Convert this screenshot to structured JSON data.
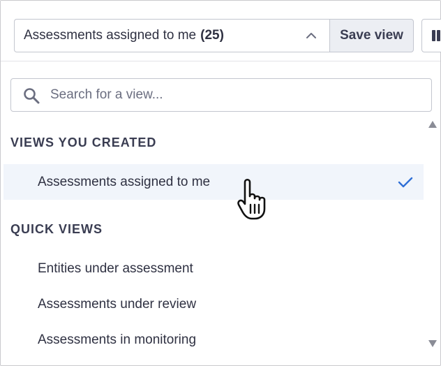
{
  "view_select": {
    "label": "Assessments assigned to me",
    "count": "(25)",
    "chevron_icon": "chevron-up-icon"
  },
  "toolbar": {
    "save_label": "Save view",
    "extra_icon": "columns-icon"
  },
  "search": {
    "placeholder": "Search for a view...",
    "value": "",
    "icon": "search-icon"
  },
  "sections": {
    "created": {
      "header": "VIEWS YOU CREATED",
      "items": [
        {
          "label": "Assessments assigned to me",
          "selected": true
        }
      ]
    },
    "quick": {
      "header": "QUICK VIEWS",
      "items": [
        {
          "label": "Entities under assessment"
        },
        {
          "label": "Assessments under review"
        },
        {
          "label": "Assessments in monitoring"
        }
      ]
    }
  },
  "colors": {
    "text": "#2f3142",
    "border": "#c3c6cf",
    "selected_bg": "#f1f5fb",
    "accent_check": "#2f6fd6",
    "save_bg": "#eceef3"
  }
}
